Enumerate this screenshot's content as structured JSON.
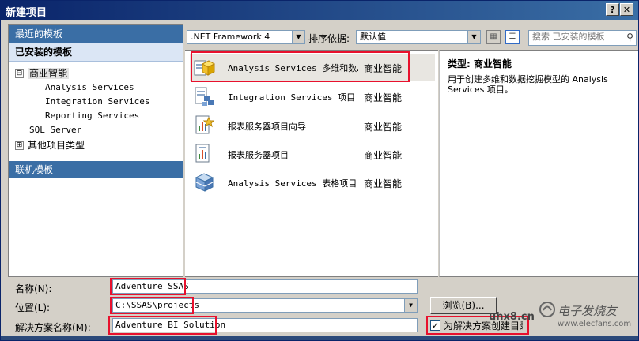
{
  "window": {
    "title": "新建项目",
    "help_label": "?",
    "close_label": "✕"
  },
  "left_panel": {
    "recent_templates": "最近的模板",
    "installed_templates": "已安装的模板",
    "tree": [
      {
        "label": "商业智能",
        "expander": "⊟"
      },
      {
        "label": "Analysis Services"
      },
      {
        "label": "Integration Services"
      },
      {
        "label": "Reporting Services"
      },
      {
        "label": "SQL Server"
      },
      {
        "label": "其他项目类型",
        "expander": "⊞"
      }
    ],
    "online_templates": "联机模板"
  },
  "toolbar": {
    "framework": ".NET Framework 4",
    "sort_label": "排序依据:",
    "sort_value": "默认值",
    "search_placeholder": "搜索 已安装的模板"
  },
  "templates": [
    {
      "name": "Analysis Services 多维和数据挖掘项目",
      "display_name": "Analysis Services 多维和数…",
      "category": "商业智能",
      "icon": "cube-project-icon",
      "selected": true
    },
    {
      "name": "Integration Services 项目",
      "category": "商业智能",
      "icon": "ssis-project-icon"
    },
    {
      "name": "报表服务器项目向导",
      "category": "商业智能",
      "icon": "report-wizard-icon"
    },
    {
      "name": "报表服务器项目",
      "category": "商业智能",
      "icon": "report-project-icon"
    },
    {
      "name": "Analysis Services 表格项目",
      "category": "商业智能",
      "icon": "tabular-project-icon"
    }
  ],
  "details": {
    "type_label": "类型: 商业智能",
    "description": "用于创建多维和数据挖掘模型的 Analysis Services 项目。"
  },
  "form": {
    "name_label": "名称(N):",
    "name_value": "Adventure SSAS",
    "location_label": "位置(L):",
    "location_value": "C:\\SSAS\\projects",
    "browse_label": "浏览(B)...",
    "solution_label": "解决方案名称(M):",
    "solution_value": "Adventure BI Solution",
    "create_dir_label": "为解决方案创建目录",
    "create_dir_checked": true
  },
  "watermark": {
    "site": "uhx8.cn",
    "logo_text": "电子发烧友",
    "url": "www.elecfans.com"
  },
  "colors": {
    "title_start": "#0a246a",
    "title_end": "#3a6ea5",
    "highlight_box": "#e8112d",
    "panel_header": "#3a6ea5"
  }
}
